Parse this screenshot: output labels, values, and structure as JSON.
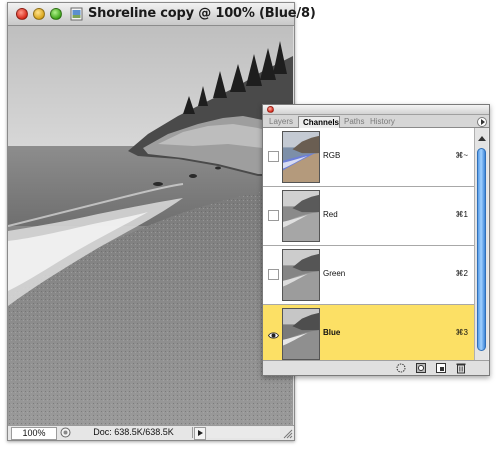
{
  "document": {
    "title": "Shoreline copy @ 100% (Blue/8)",
    "zoom": "100%",
    "doc_info": "Doc: 638.5K/638.5K"
  },
  "palette": {
    "tabs": [
      {
        "label": "Layers",
        "active": false
      },
      {
        "label": "Channels",
        "active": true
      },
      {
        "label": "Paths",
        "active": false
      },
      {
        "label": "History",
        "active": false
      }
    ],
    "channels": [
      {
        "name": "RGB",
        "shortcut": "⌘~",
        "visible": false,
        "selected": false
      },
      {
        "name": "Red",
        "shortcut": "⌘1",
        "visible": false,
        "selected": false
      },
      {
        "name": "Green",
        "shortcut": "⌘2",
        "visible": false,
        "selected": false
      },
      {
        "name": "Blue",
        "shortcut": "⌘3",
        "visible": true,
        "selected": true
      }
    ],
    "bottom_icons": [
      "load-selection-icon",
      "save-selection-icon",
      "new-channel-icon",
      "trash-icon"
    ]
  },
  "colors": {
    "selected_row": "#fce065",
    "scrollbar_blue": "#5a9ee8"
  }
}
